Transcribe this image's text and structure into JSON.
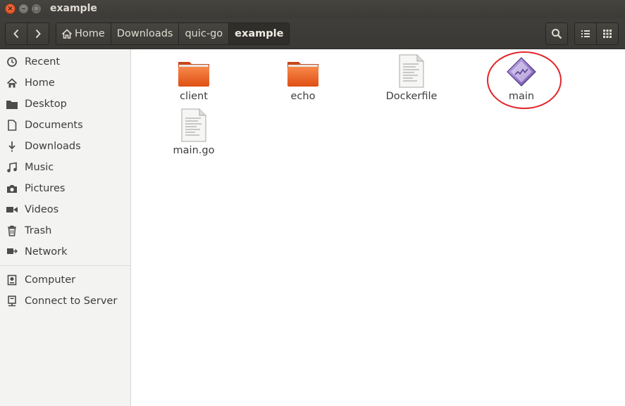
{
  "window": {
    "title": "example",
    "close_glyph": "×",
    "minimize_glyph": "–",
    "maximize_glyph": "□"
  },
  "toolbar": {
    "back_icon": "chevron-left-icon",
    "forward_icon": "chevron-right-icon",
    "breadcrumbs": [
      "Home",
      "Downloads",
      "quic-go",
      "example"
    ],
    "active_crumb": "example",
    "search_icon": "search-icon",
    "view_list_icon": "list-view-icon",
    "view_grid_icon": "grid-view-icon"
  },
  "sidebar": {
    "items": [
      {
        "label": "Recent",
        "icon": "clock-icon"
      },
      {
        "label": "Home",
        "icon": "home-icon"
      },
      {
        "label": "Desktop",
        "icon": "folder-icon"
      },
      {
        "label": "Documents",
        "icon": "document-icon"
      },
      {
        "label": "Downloads",
        "icon": "download-icon"
      },
      {
        "label": "Music",
        "icon": "music-icon"
      },
      {
        "label": "Pictures",
        "icon": "camera-icon"
      },
      {
        "label": "Videos",
        "icon": "video-icon"
      },
      {
        "label": "Trash",
        "icon": "trash-icon"
      },
      {
        "label": "Network",
        "icon": "network-icon"
      },
      {
        "label": "Computer",
        "icon": "computer-icon"
      },
      {
        "label": "Connect to Server",
        "icon": "server-icon"
      }
    ]
  },
  "files": [
    {
      "name": "client",
      "type": "folder"
    },
    {
      "name": "echo",
      "type": "folder"
    },
    {
      "name": "Dockerfile",
      "type": "text-document"
    },
    {
      "name": "main",
      "type": "executable",
      "highlighted": true
    },
    {
      "name": "main.go",
      "type": "text-document"
    }
  ],
  "colors": {
    "folder": "#f06a2c",
    "highlight": "#e0262a",
    "titlebar": "#3c3b37"
  }
}
